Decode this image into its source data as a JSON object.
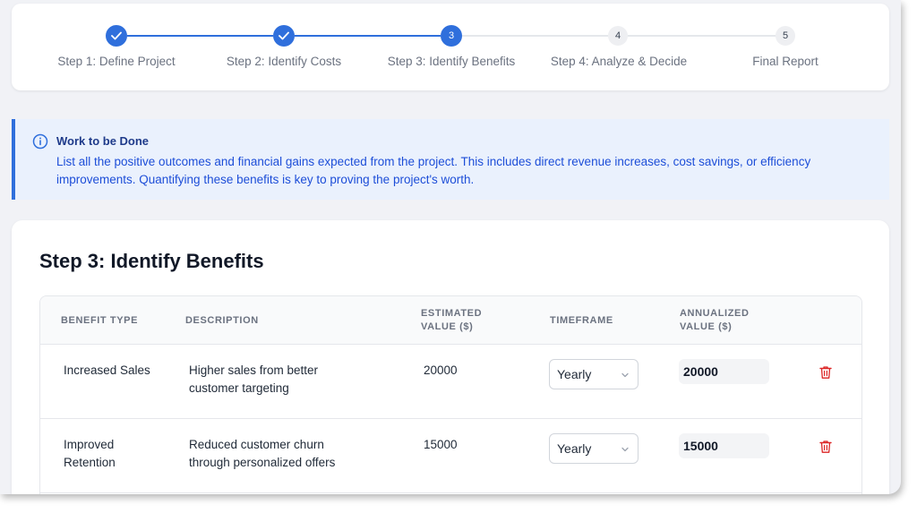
{
  "colors": {
    "accent": "#2f6fdc",
    "info_bg": "#eaf1fd",
    "delete": "#dc2626"
  },
  "stepper": {
    "steps": [
      {
        "label": "Step 1: Define Project",
        "number": "1",
        "status": "completed"
      },
      {
        "label": "Step 2: Identify Costs",
        "number": "2",
        "status": "completed"
      },
      {
        "label": "Step 3: Identify Benefits",
        "number": "3",
        "status": "active"
      },
      {
        "label": "Step 4: Analyze & Decide",
        "number": "4",
        "status": "upcoming"
      },
      {
        "label": "Final Report",
        "number": "5",
        "status": "upcoming"
      }
    ]
  },
  "info": {
    "icon": "info-icon",
    "title": "Work to be Done",
    "body": "List all the positive outcomes and financial gains expected from the project. This includes direct revenue increases, cost savings, or efficiency improvements. Quantifying these benefits is key to proving the project's worth."
  },
  "main": {
    "title": "Step 3: Identify Benefits",
    "table": {
      "headers": [
        "BENEFIT TYPE",
        "DESCRIPTION",
        "ESTIMATED VALUE ($)",
        "TIMEFRAME",
        "ANNUALIZED VALUE ($)"
      ],
      "rows": [
        {
          "type": "Increased Sales",
          "description": "Higher sales from better customer targeting",
          "estimated": "20000",
          "timeframe": "Yearly",
          "annualized": "20000",
          "delete_icon": "trash-icon"
        },
        {
          "type": "Improved Retention",
          "description": "Reduced customer churn through personalized offers",
          "estimated": "15000",
          "timeframe": "Yearly",
          "annualized": "15000",
          "delete_icon": "trash-icon"
        }
      ]
    }
  }
}
